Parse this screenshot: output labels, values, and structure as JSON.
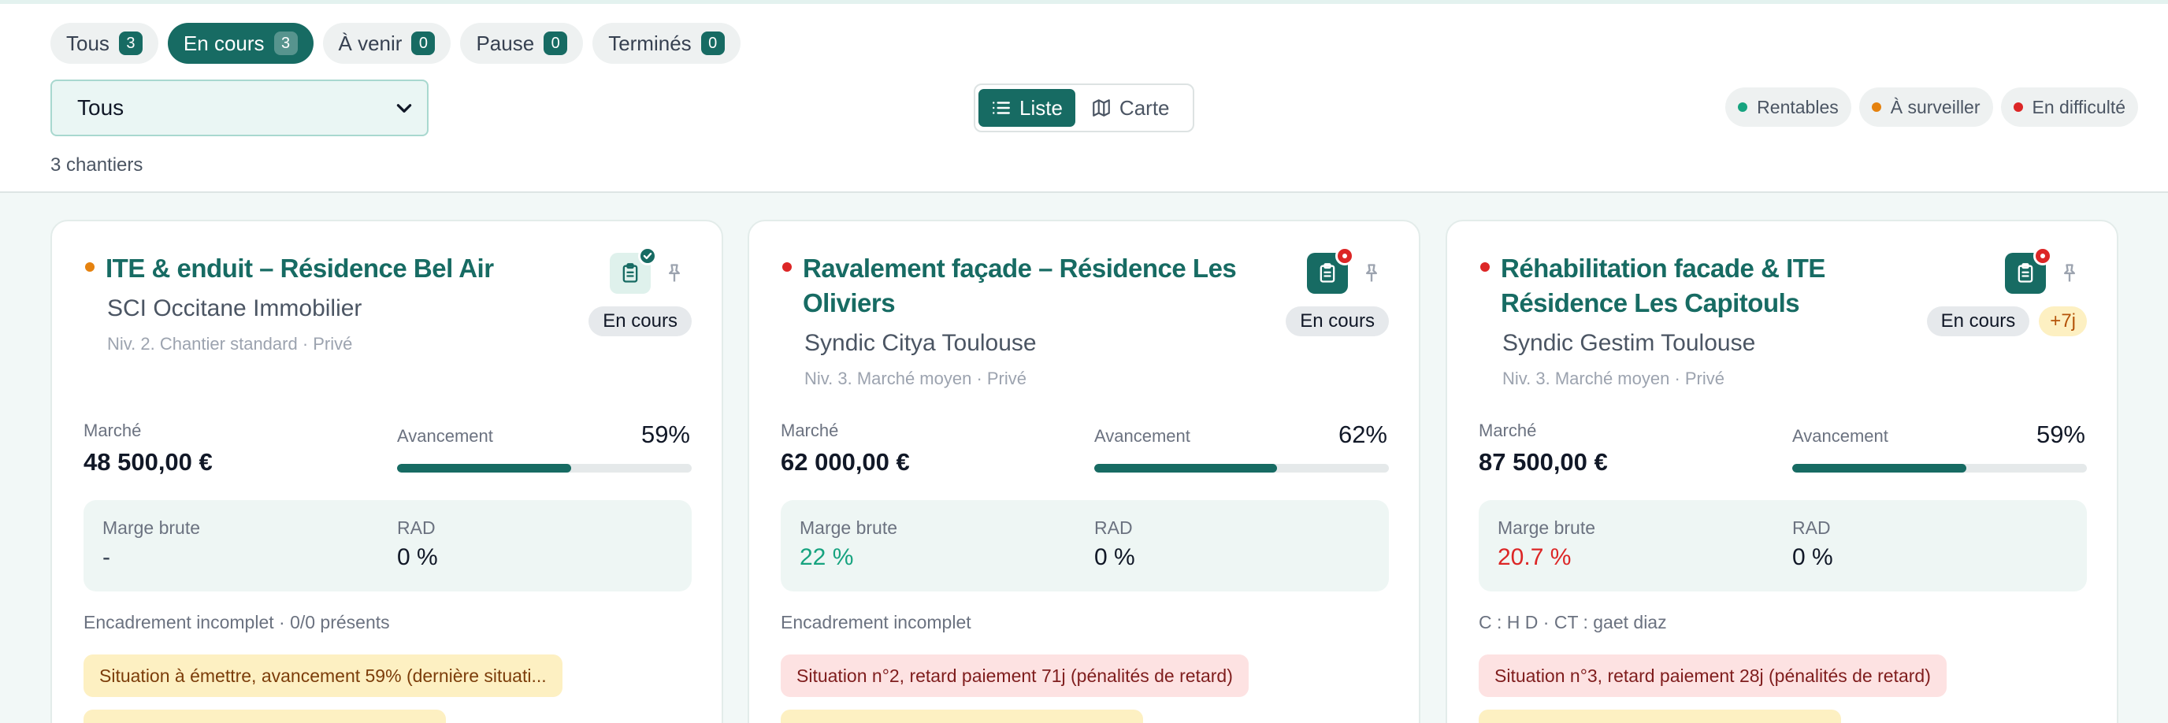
{
  "tabs": [
    {
      "label": "Tous",
      "count": "3",
      "active": false
    },
    {
      "label": "En cours",
      "count": "3",
      "active": true
    },
    {
      "label": "À venir",
      "count": "0",
      "active": false
    },
    {
      "label": "Pause",
      "count": "0",
      "active": false
    },
    {
      "label": "Terminés",
      "count": "0",
      "active": false
    }
  ],
  "filter": {
    "selected": "Tous"
  },
  "view": {
    "list_label": "Liste",
    "map_label": "Carte",
    "active": "list"
  },
  "legend": [
    {
      "label": "Rentables",
      "color": "#16a37f"
    },
    {
      "label": "À surveiller",
      "color": "#e5820f"
    },
    {
      "label": "En difficulté",
      "color": "#dc2626"
    }
  ],
  "summary": {
    "count_text": "3 chantiers"
  },
  "labels": {
    "marche": "Marché",
    "avancement": "Avancement",
    "marge": "Marge brute",
    "rad": "RAD"
  },
  "colors": {
    "accent": "#176b63",
    "positive": "#16a37f",
    "negative": "#dc2626"
  },
  "cards": [
    {
      "title": "ITE & enduit – Résidence Bel Air",
      "client": "SCI Occitane Immobilier",
      "meta": "Niv. 2. Chantier standard · Privé",
      "status": "En cours",
      "delay": "",
      "health_color": "#e5820f",
      "doc_state": "validated",
      "marche": "48 500,00 €",
      "progress": 59,
      "progress_label": "59%",
      "marge": "-",
      "marge_tone": "neutral",
      "rad": "0 %",
      "note": "Encadrement incomplet · 0/0 présents",
      "alert": "Situation à émettre, avancement 59% (dernière situati...",
      "alert_tone": "warn"
    },
    {
      "title": "Ravalement façade – Résidence Les Oliviers",
      "client": "Syndic Citya Toulouse",
      "meta": "Niv. 3. Marché moyen · Privé",
      "status": "En cours",
      "delay": "",
      "health_color": "#dc2626",
      "doc_state": "alert",
      "marche": "62 000,00 €",
      "progress": 62,
      "progress_label": "62%",
      "marge": "22 %",
      "marge_tone": "positive",
      "rad": "0 %",
      "note": "Encadrement incomplet",
      "alert": "Situation n°2, retard paiement 71j (pénalités de retard)",
      "alert_tone": "danger"
    },
    {
      "title": "Réhabilitation facade & ITE Résidence Les Capitouls",
      "client": "Syndic Gestim Toulouse",
      "meta": "Niv. 3. Marché moyen · Privé",
      "status": "En cours",
      "delay": "+7j",
      "health_color": "#dc2626",
      "doc_state": "alert",
      "marche": "87 500,00 €",
      "progress": 59,
      "progress_label": "59%",
      "marge": "20.7 %",
      "marge_tone": "negative",
      "rad": "0 %",
      "note": "C : H D · CT : gaet diaz",
      "alert": "Situation n°3, retard paiement 28j (pénalités de retard)",
      "alert_tone": "danger"
    }
  ]
}
